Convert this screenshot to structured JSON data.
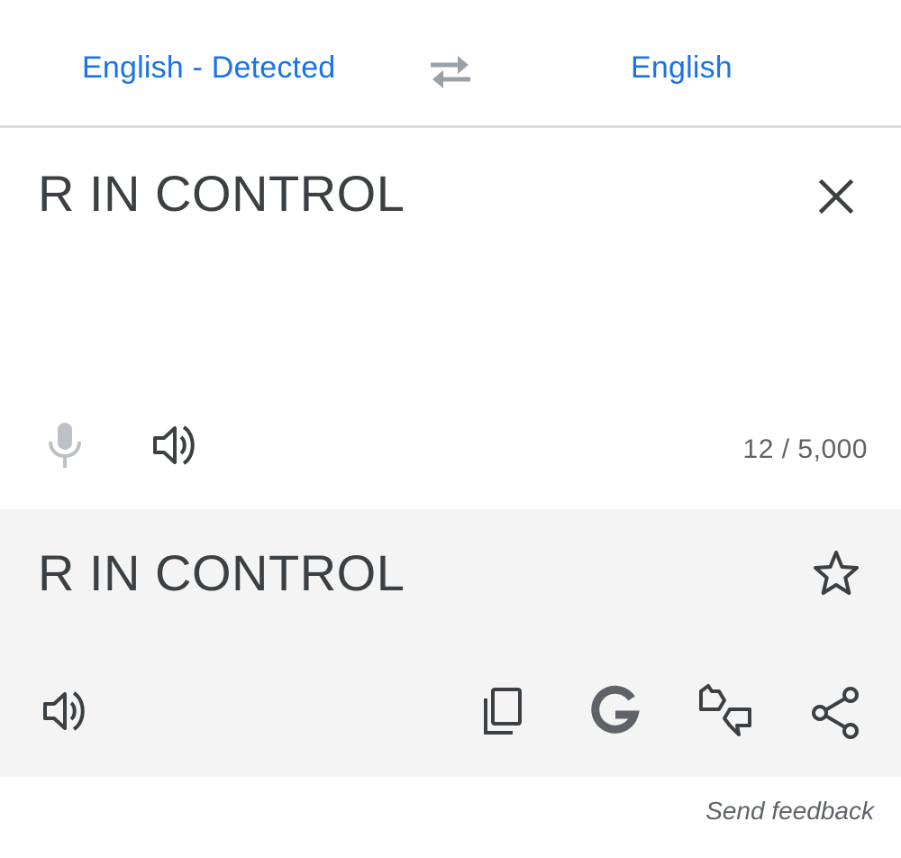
{
  "header": {
    "source_language": "English - Detected",
    "target_language": "English",
    "swap_icon": "swap-horiz-icon"
  },
  "source": {
    "text": "R IN CONTROL",
    "char_count": "12 / 5,000",
    "icons": [
      "close-icon",
      "mic-icon",
      "volume-icon"
    ]
  },
  "result": {
    "text": "R IN CONTROL",
    "icons": [
      "star-outline-icon",
      "volume-icon",
      "copy-icon",
      "google-icon",
      "feedback-icon",
      "share-icon"
    ]
  },
  "footer": {
    "send_feedback": "Send feedback"
  },
  "colors": {
    "accent": "#1a73e8",
    "text": "#3c4043",
    "muted": "#5f6368",
    "result_bg": "#f4f4f4",
    "divider": "#dadce0"
  }
}
